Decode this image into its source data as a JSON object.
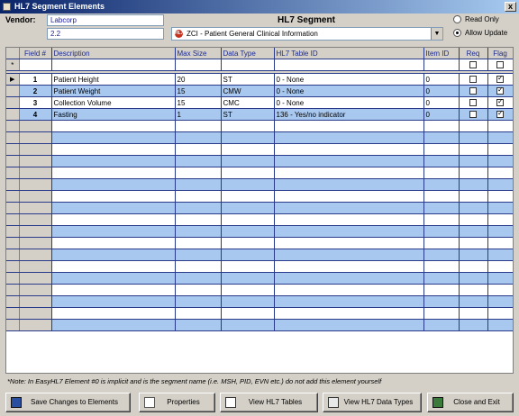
{
  "window": {
    "title": "HL7 Segment Elements",
    "close": "x"
  },
  "vendor": {
    "label": "Vendor:",
    "name": "Labcorp",
    "version": "2.2"
  },
  "segment": {
    "heading": "HL7 Segment",
    "selected": "ZCI - Patient General Clinical Information",
    "icon_text": "HL7"
  },
  "mode": {
    "read_only": "Read Only",
    "allow_update": "Allow Update",
    "selected": "allow_update"
  },
  "grid": {
    "columns": [
      "Field #",
      "Description",
      "Max Size",
      "Data Type",
      "HL7 Table ID",
      "Item ID",
      "Req",
      "Flag"
    ],
    "new_row_marker": "*",
    "current_row_marker": "▶",
    "rows": [
      {
        "field": "1",
        "description": "Patient Height",
        "max_size": "20",
        "data_type": "ST",
        "table_id": "0 - None",
        "item_id": "0",
        "req": false,
        "flag": true
      },
      {
        "field": "2",
        "description": "Patient Weight",
        "max_size": "15",
        "data_type": "CMW",
        "table_id": "0 - None",
        "item_id": "0",
        "req": false,
        "flag": true
      },
      {
        "field": "3",
        "description": "Collection Volume",
        "max_size": "15",
        "data_type": "CMC",
        "table_id": "0 - None",
        "item_id": "0",
        "req": false,
        "flag": true
      },
      {
        "field": "4",
        "description": "Fasting",
        "max_size": "1",
        "data_type": "ST",
        "table_id": "136 - Yes/no indicator",
        "item_id": "0",
        "req": false,
        "flag": true
      }
    ]
  },
  "note": "*Note:  In EasyHL7 Element #0 is implicit and is the segment name (i.e. MSH, PID, EVN etc.) do not add this element yourself",
  "buttons": {
    "save": "Save Changes to Elements",
    "properties": "Properties",
    "view_tables": "View HL7 Tables",
    "view_types": "View HL7 Data Types",
    "close_exit": "Close and Exit"
  },
  "colors": {
    "title_start": "#0a246a",
    "title_end": "#a6caf0",
    "row_blue": "#a8c8f0",
    "grid_line": "#2a3a8a",
    "face": "#d4d0c8"
  }
}
